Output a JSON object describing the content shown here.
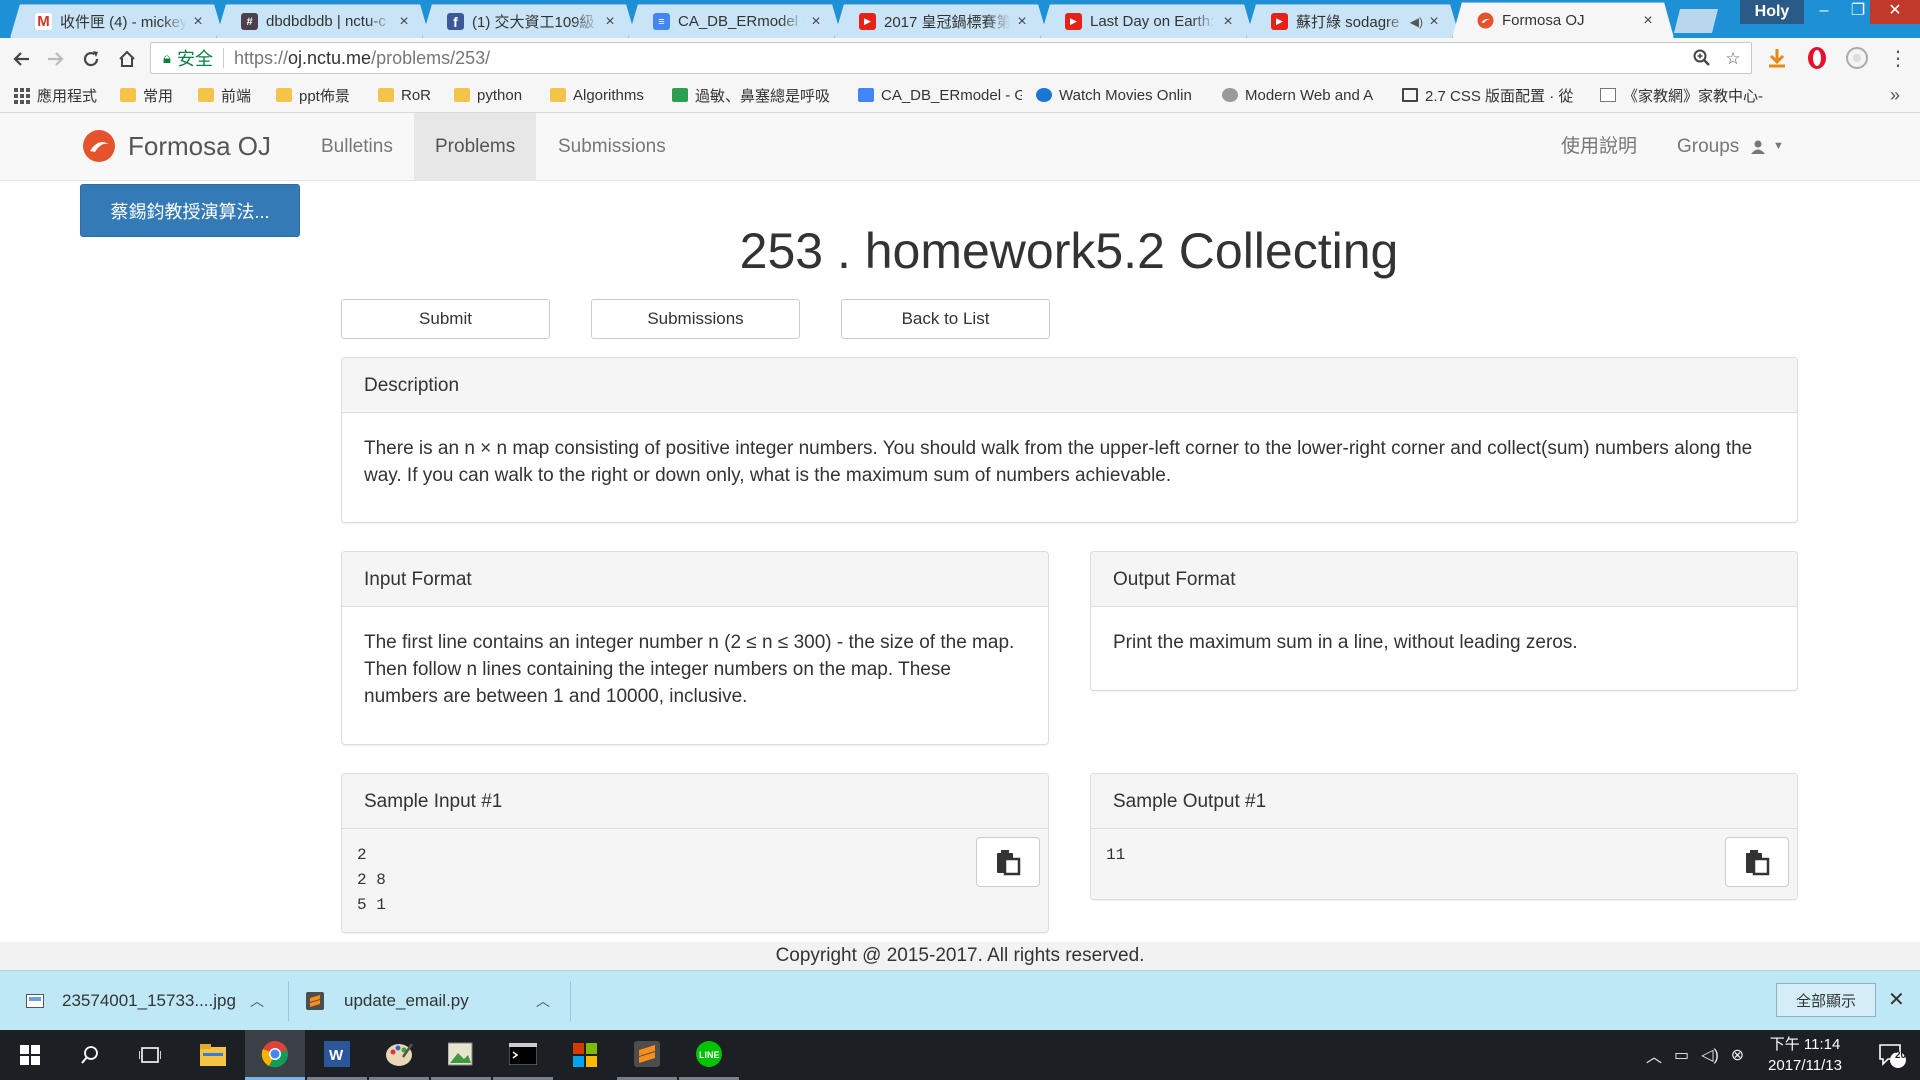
{
  "browser": {
    "tabs": [
      {
        "title": "收件匣 (4) - mickey",
        "icon": "gmail-icon",
        "active": false
      },
      {
        "title": "dbdbdbdb | nctu-c",
        "icon": "slack-icon",
        "active": false
      },
      {
        "title": "(1) 交大資工109級",
        "icon": "facebook-icon",
        "active": false
      },
      {
        "title": "CA_DB_ERmodel -",
        "icon": "google-docs-icon",
        "active": false
      },
      {
        "title": "2017 皇冠鍋標賽第",
        "icon": "youtube-icon",
        "active": false
      },
      {
        "title": "Last Day on Earth:",
        "icon": "youtube-icon",
        "active": false
      },
      {
        "title": "蘇打綠 sodagre",
        "icon": "youtube-icon",
        "active": false
      },
      {
        "title": "Formosa OJ",
        "icon": "formosa-oj-icon",
        "active": true
      }
    ],
    "profile_name": "Holy",
    "secure_label": "安全",
    "url_scheme": "https://",
    "url_host": "oj.nctu.me",
    "url_path": "/problems/253/",
    "bookmarks": [
      {
        "label": "應用程式",
        "icon": "apps-grid-icon"
      },
      {
        "label": "常用",
        "icon": "folder-icon"
      },
      {
        "label": "前端",
        "icon": "folder-icon"
      },
      {
        "label": "ppt佈景",
        "icon": "folder-icon"
      },
      {
        "label": "RoR",
        "icon": "folder-icon"
      },
      {
        "label": "python",
        "icon": "folder-icon"
      },
      {
        "label": "Algorithms",
        "icon": "folder-icon"
      },
      {
        "label": "過敏、鼻塞總是呼吸",
        "icon": "sheet-icon"
      },
      {
        "label": "CA_DB_ERmodel - G",
        "icon": "google-docs-icon"
      },
      {
        "label": "Watch Movies Onlin",
        "icon": "movie-icon"
      },
      {
        "label": "Modern Web and A",
        "icon": "globe-icon"
      },
      {
        "label": "2.7 CSS 版面配置 · 從",
        "icon": "book-icon"
      },
      {
        "label": "《家教網》家教中心-",
        "icon": "page-icon"
      }
    ]
  },
  "site": {
    "brand": "Formosa OJ",
    "nav": [
      {
        "label": "Bulletins",
        "active": false
      },
      {
        "label": "Problems",
        "active": true
      },
      {
        "label": "Submissions",
        "active": false
      }
    ],
    "nav_right": {
      "help": "使用說明",
      "groups": "Groups"
    },
    "course_button": "蔡錫鈞教授演算法..."
  },
  "problem": {
    "title": "253 . homework5.2 Collecting",
    "actions": {
      "submit": "Submit",
      "submissions": "Submissions",
      "back": "Back to List"
    },
    "description": {
      "heading": "Description",
      "body": "There is an n × n map consisting of positive integer numbers. You should walk from the upper-left corner to the lower-right corner and collect(sum) numbers along the way. If you can walk to the right or down only, what is the maximum sum of numbers achievable."
    },
    "input_format": {
      "heading": "Input Format",
      "body": "The first line contains an integer number n (2 ≤ n ≤ 300) - the size of the map. Then follow n lines containing the integer numbers on the map. These numbers are between 1 and 10000, inclusive."
    },
    "output_format": {
      "heading": "Output Format",
      "body": "Print the maximum sum in a line, without leading zeros."
    },
    "sample_input": {
      "heading": "Sample Input #1",
      "body": "2\n2 8\n5 1"
    },
    "sample_output": {
      "heading": "Sample Output #1",
      "body": "11"
    }
  },
  "footer": {
    "text": "Copyright @ 2015-2017. All rights reserved."
  },
  "downloads": {
    "items": [
      {
        "name": "23574001_15733....jpg",
        "icon": "image-file-icon"
      },
      {
        "name": "update_email.py",
        "icon": "sublime-file-icon"
      }
    ],
    "show_all": "全部顯示"
  },
  "taskbar": {
    "clock_time": "下午 11:14",
    "clock_date": "2017/11/13",
    "notification_count": "20"
  },
  "colors": {
    "primary": "#337ab7",
    "tabstrip": "#1e90d6",
    "brand_logo": "#e4532b"
  }
}
